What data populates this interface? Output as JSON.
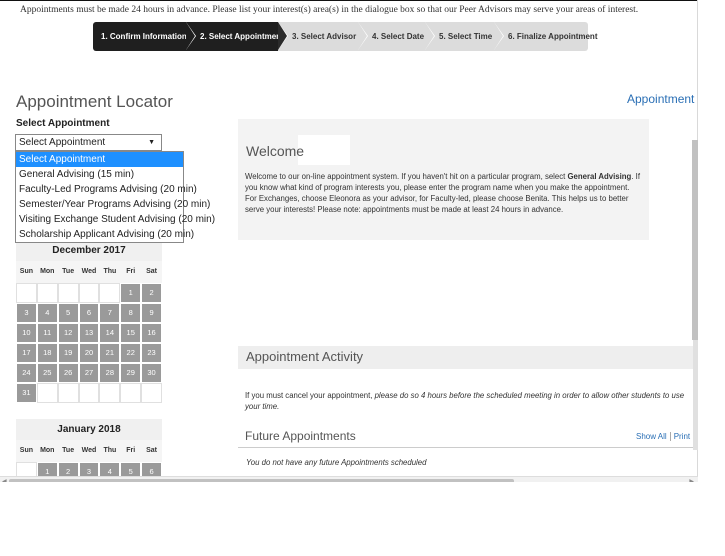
{
  "notice": "Appointments must be made 24 hours in advance. Please list your interest(s) area(s) in the dialogue box so that our Peer Advisors may serve your areas of interest.",
  "steps": [
    {
      "label": "1. Confirm Information"
    },
    {
      "label": "2. Select Appointment"
    },
    {
      "label": "3. Select Advisor"
    },
    {
      "label": "4. Select Date"
    },
    {
      "label": "5. Select Time"
    },
    {
      "label": "6. Finalize Appointment"
    }
  ],
  "locator": {
    "title": "Appointment Locator",
    "appointment_link": "Appointment Ac",
    "select_label": "Select Appointment",
    "select_value": "Select Appointment",
    "options": [
      "Select Appointment",
      "General Advising (15 min)",
      "Faculty-Led Programs Advising (20 min)",
      "Semester/Year Programs Advising (20 min)",
      "Visiting Exchange Student Advising (20 min)",
      "Scholarship Applicant Advising (20 min)"
    ]
  },
  "calendars": [
    {
      "title": "December 2017",
      "dow": [
        "Sun",
        "Mon",
        "Tue",
        "Wed",
        "Thu",
        "Fri",
        "Sat"
      ],
      "days": [
        "",
        "",
        "",
        "",
        "",
        "1",
        "2",
        "3",
        "4",
        "5",
        "6",
        "7",
        "8",
        "9",
        "10",
        "11",
        "12",
        "13",
        "14",
        "15",
        "16",
        "17",
        "18",
        "19",
        "20",
        "21",
        "22",
        "23",
        "24",
        "25",
        "26",
        "27",
        "28",
        "29",
        "30",
        "31",
        "",
        "",
        "",
        "",
        "",
        ""
      ]
    },
    {
      "title": "January 2018",
      "dow": [
        "Sun",
        "Mon",
        "Tue",
        "Wed",
        "Thu",
        "Fri",
        "Sat"
      ],
      "days": [
        "",
        "1",
        "2",
        "3",
        "4",
        "5",
        "6"
      ]
    }
  ],
  "welcome": {
    "title": "Welcome",
    "text_before_bold": "Welcome to our on-line appointment system. If you  haven't hit on a particular program, select ",
    "bold": "General Advising",
    "text_after_bold": ". If you know what kind of program interests you, please enter the program name when you make the appointment. For Exchanges, choose Eleonora as your advisor, for Faculty-led, please choose Benita. This helps us to better serve your interests! Please note: appointments must be made at least 24 hours in advance."
  },
  "activity": {
    "title": "Appointment Activity",
    "cancel_before_italic": "If you must cancel your appointment, ",
    "cancel_italic": "please do so 4 hours before the scheduled meeting in order to allow other students to use your time.",
    "future_title": "Future Appointments",
    "show_all": "Show All",
    "print": "Print ,",
    "no_appointments": "You do not have any future Appointments scheduled"
  }
}
